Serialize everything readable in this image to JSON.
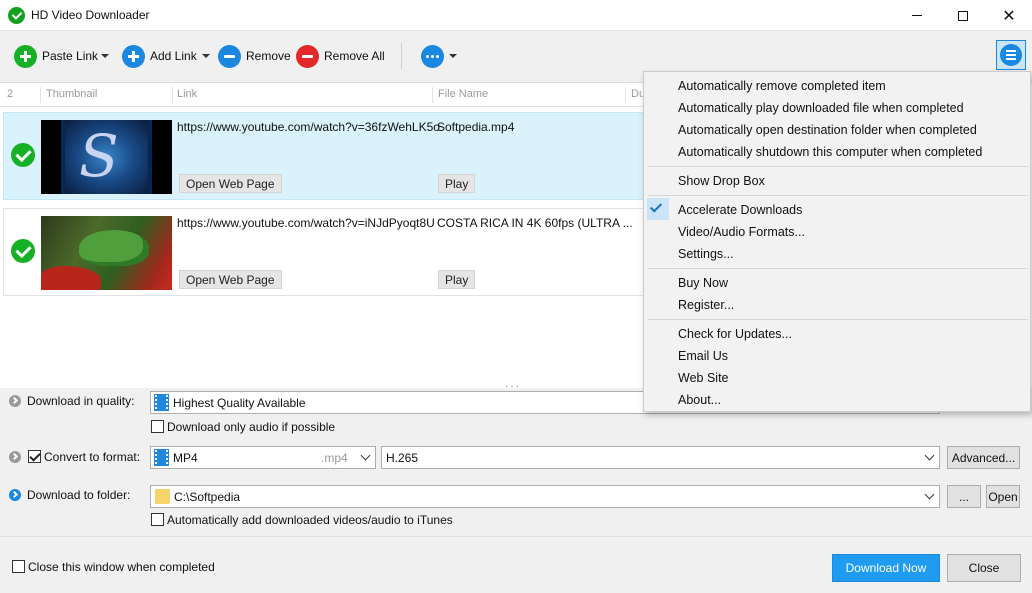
{
  "window": {
    "title": "HD Video Downloader",
    "minimize_label": "—",
    "close_label": "✕"
  },
  "toolbar": {
    "paste_link": "Paste Link",
    "add_link": "Add Link",
    "remove": "Remove",
    "remove_all": "Remove All"
  },
  "list": {
    "columns": {
      "count": "2",
      "thumbnail": "Thumbnail",
      "link": "Link",
      "file_name": "File Name",
      "duration_partial": "Du"
    },
    "items": [
      {
        "link": "https://www.youtube.com/watch?v=36fzWehLK5o",
        "file_name": "Softpedia.mp4",
        "open_web_page": "Open Web Page",
        "play": "Play",
        "thumb_letter": "S"
      },
      {
        "link": "https://www.youtube.com/watch?v=iNJdPyoqt8U",
        "file_name": "COSTA RICA IN 4K 60fps (ULTRA ...",
        "open_web_page": "Open Web Page",
        "play": "Play"
      }
    ],
    "grip": "..."
  },
  "settings": {
    "quality_label": "Download in quality:",
    "quality_value": "Highest Quality Available",
    "audio_only_label": "Download only audio if possible",
    "convert_label": "Convert to format:",
    "format_value": "MP4",
    "format_ext": ".mp4",
    "codec_value": "H.265",
    "advanced_button": "Advanced...",
    "folder_label": "Download to folder:",
    "folder_value": "C:\\Softpedia",
    "browse_button": "...",
    "open_button": "Open",
    "itunes_label": "Automatically add downloaded videos/audio to iTunes",
    "close_when_done_label": "Close this window when completed",
    "download_now_button": "Download Now",
    "close_button": "Close"
  },
  "menu": {
    "auto_remove": "Automatically remove completed item",
    "auto_play": "Automatically play downloaded file when completed",
    "auto_open_folder": "Automatically open destination folder when completed",
    "auto_shutdown": "Automatically shutdown this computer when completed",
    "show_drop_box": "Show Drop Box",
    "accelerate": "Accelerate Downloads",
    "formats": "Video/Audio Formats...",
    "settings": "Settings...",
    "buy_now": "Buy Now",
    "register": "Register...",
    "check_updates": "Check for Updates...",
    "email_us": "Email Us",
    "web_site": "Web Site",
    "about": "About..."
  },
  "state": {
    "convert_checked": true,
    "audio_only_checked": false,
    "itunes_checked": false,
    "close_when_done_checked": false,
    "accelerate_checked": true
  },
  "colors": {
    "accent_blue": "#1a87e0",
    "success_green": "#16b025",
    "remove_red": "#e22828",
    "selected_row": "#d9f2fb",
    "primary_button": "#1f9bef"
  },
  "icons": [
    "app-download-icon",
    "plus-icon",
    "minus-icon",
    "more-icon",
    "hamburger-menu-icon",
    "check-circle-icon",
    "film-icon",
    "folder-icon",
    "chevron-right-icon",
    "checkmark-icon"
  ]
}
